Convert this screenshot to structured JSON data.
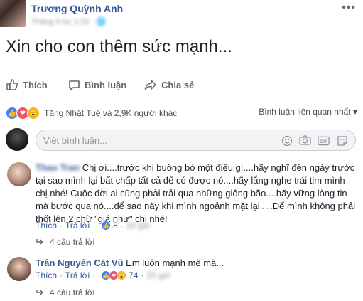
{
  "post": {
    "author": "Trương Quỳnh Anh",
    "meta": "Tháng 9 lúc 1:52 · 🌐",
    "text": "Xin cho con thêm sức mạnh..."
  },
  "actions": {
    "like": "Thích",
    "comment": "Bình luận",
    "share": "Chia sẻ"
  },
  "reactions": {
    "summary": "Tăng Nhật Tuệ và 2,9K người khác",
    "filter": "Bình luận liên quan nhất ▾"
  },
  "comment_box": {
    "placeholder": "Viết bình luận..."
  },
  "comments": [
    {
      "name": "Thao Tran",
      "text": "Chị ơi....trước khi buông bỏ một điều gì....hãy nghĩ đến ngày trước tại sao mình lại bất chấp tất cả để có được nó....hãy lắng nghe trái tim mình chị nhé! Cuộc đời ai cũng phải trải qua những giông bão....hãy vững lòng tin mà bước qua nó....để sao này khi mình ngoảnh mặt lại.....Để mình không phải thốt lên 2 chữ \"giá như\" chị nhé!",
      "like": "Thích",
      "reply": "Trả lời",
      "count": "8",
      "time": "20 giờ",
      "replies": "4 câu trả lời"
    },
    {
      "name": "Trần Nguyên Cát Vũ",
      "text": "Em luôn mạnh mẽ mà...",
      "like": "Thích",
      "reply": "Trả lời",
      "count": "74",
      "time": "20 giờ",
      "replies": "4 câu trả lời"
    }
  ],
  "colors": {
    "link": "#365899",
    "like": "#4080ff",
    "love": "#f25268",
    "wow": "#f7b125"
  }
}
